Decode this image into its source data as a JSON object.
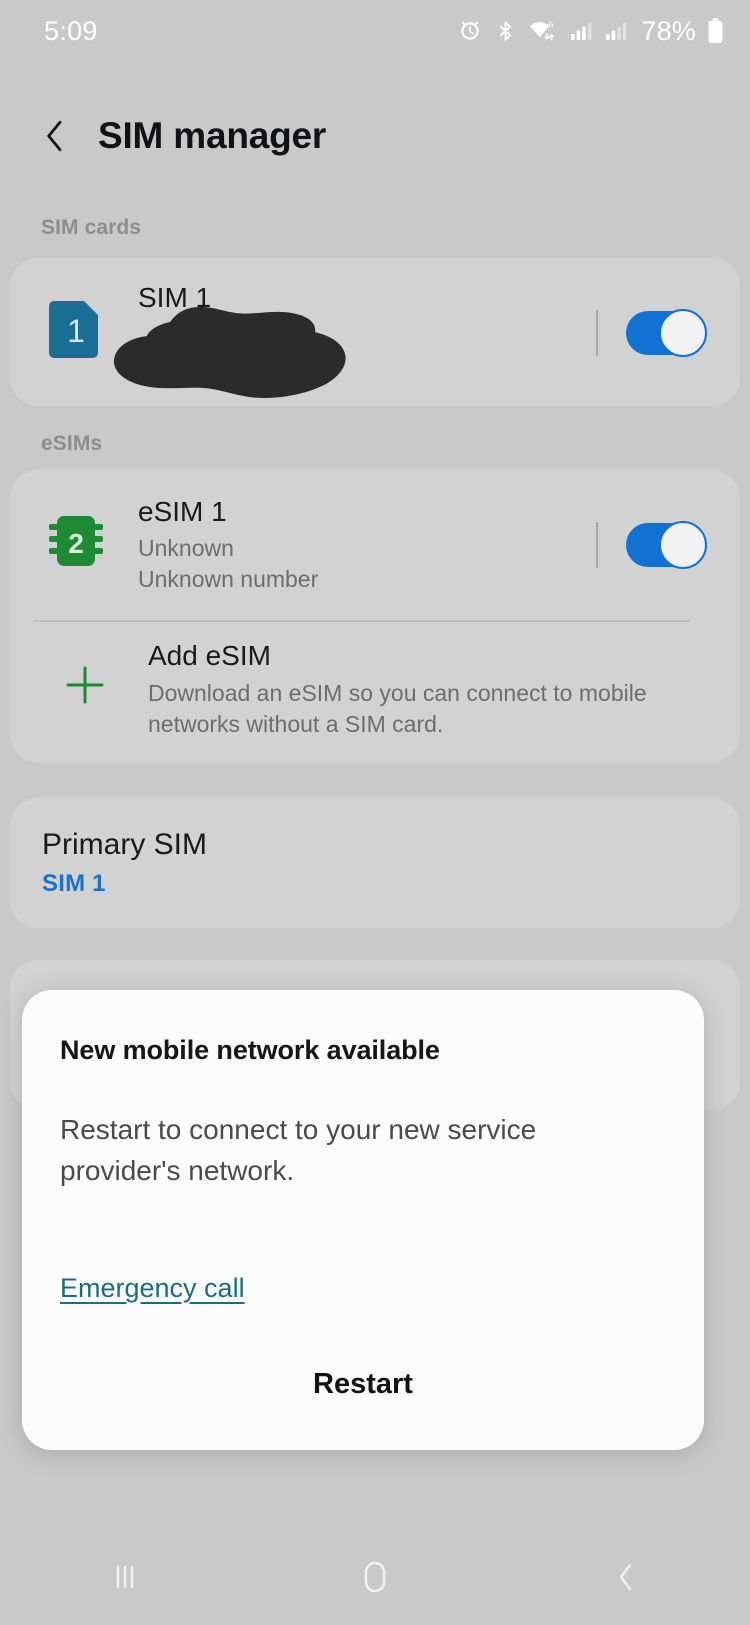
{
  "statusbar": {
    "time": "5:09",
    "battery_percent": "78%",
    "icons": [
      "alarm-icon",
      "bluetooth-icon",
      "wifi-icon",
      "signal-icon-1",
      "signal-icon-2",
      "battery-icon"
    ]
  },
  "header": {
    "back_label": "Back",
    "title": "SIM manager"
  },
  "sections": {
    "sim_cards_label": "SIM cards",
    "esims_label": "eSIMs"
  },
  "sim_cards": [
    {
      "badge": "1",
      "title": "SIM 1",
      "redacted": true,
      "toggle_on": true
    }
  ],
  "esims": [
    {
      "badge": "2",
      "title": "eSIM 1",
      "subtitle_1": "Unknown",
      "subtitle_2": "Unknown number",
      "toggle_on": true
    }
  ],
  "add_esim": {
    "title": "Add eSIM",
    "description": "Download an eSIM so you can connect to mobile networks without a SIM card."
  },
  "primary_sim": {
    "label": "Primary SIM",
    "value": "SIM 1"
  },
  "dialog": {
    "title": "New mobile network available",
    "body": "Restart to connect to your new service provider's network.",
    "emergency_call": "Emergency call",
    "restart": "Restart"
  },
  "navbar": {
    "recents_label": "Recents",
    "home_label": "Home",
    "back_label": "Back"
  },
  "colors": {
    "background": "#c9c9c9",
    "card": "#d2d2d2",
    "sim1_badge": "#1a6e96",
    "esim_badge": "#1f8a34",
    "toggle_on": "#1272d3",
    "link": "#1c6b80",
    "primary_value": "#1a73c8",
    "dialog": "#fbfbfb"
  }
}
